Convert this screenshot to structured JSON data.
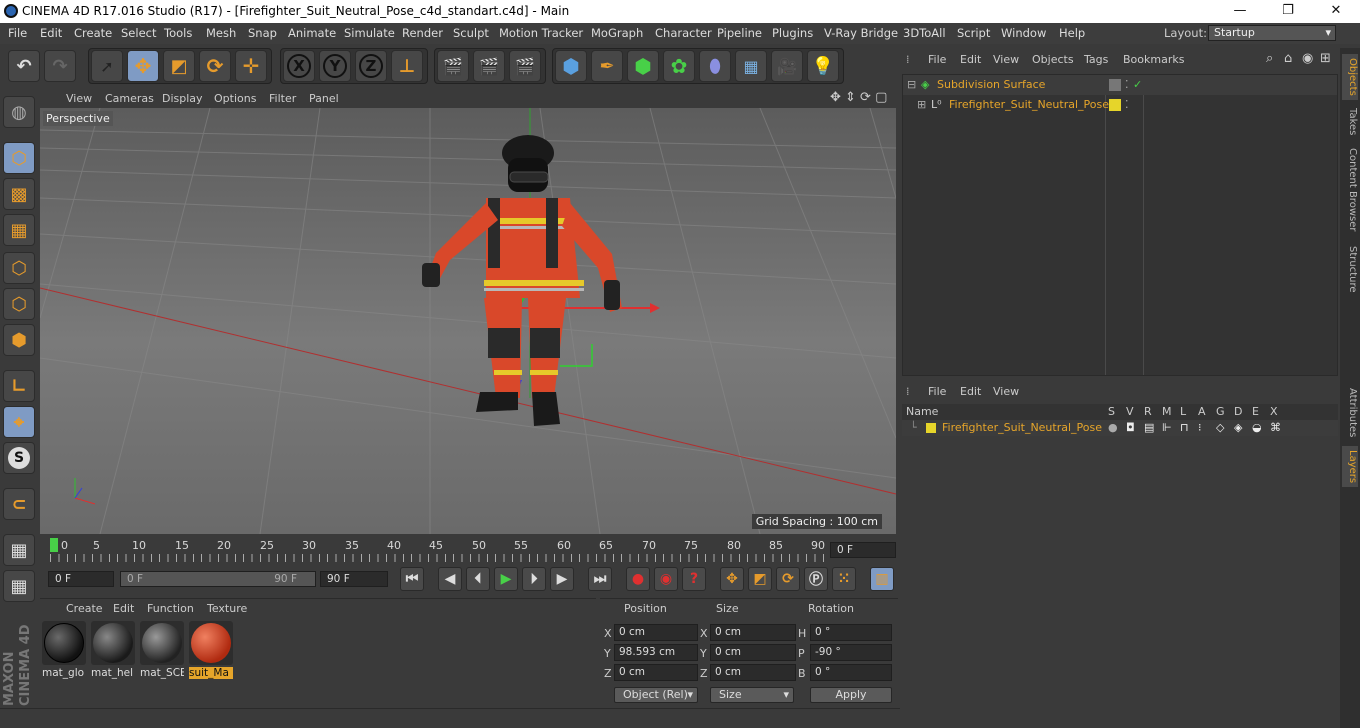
{
  "titlebar": {
    "title": "CINEMA 4D R17.016 Studio (R17) - [Firefighter_Suit_Neutral_Pose_c4d_standart.c4d] - Main",
    "minimize": "—",
    "restore": "❐",
    "close": "✕"
  },
  "menubar": {
    "items": [
      "File",
      "Edit",
      "Create",
      "Select",
      "Tools",
      "Mesh",
      "Snap",
      "Animate",
      "Simulate",
      "Render",
      "Sculpt",
      "Motion Tracker",
      "MoGraph",
      "Character",
      "Pipeline",
      "Plugins",
      "V-Ray Bridge",
      "3DToAll",
      "Script",
      "Window",
      "Help"
    ],
    "layout_label": "Layout:",
    "layout_value": "Startup"
  },
  "toolbar": {
    "axis_x": "X",
    "axis_y": "Y",
    "axis_z": "Z"
  },
  "viewport": {
    "menu": [
      "View",
      "Cameras",
      "Display",
      "Options",
      "Filter",
      "Panel"
    ],
    "camera_label": "Perspective",
    "grid_spacing": "Grid Spacing : 100 cm"
  },
  "timeline": {
    "ticks": [
      "0",
      "5",
      "10",
      "15",
      "20",
      "25",
      "30",
      "35",
      "40",
      "45",
      "50",
      "55",
      "60",
      "65",
      "70",
      "75",
      "80",
      "85",
      "90"
    ],
    "current_frame": "0 F"
  },
  "playbar": {
    "start": "0 F",
    "range_start": "0 F",
    "range_end": "90 F",
    "end": "90 F"
  },
  "materials": {
    "menu": [
      "Create",
      "Edit",
      "Function",
      "Texture"
    ],
    "items": [
      {
        "label": "mat_glo",
        "color": "#2a2a2a"
      },
      {
        "label": "mat_hel",
        "color": "#3a3a3a"
      },
      {
        "label": "mat_SCE",
        "color": "#4a4a4a"
      },
      {
        "label": "suit_Ma",
        "color": "#d24a2a"
      }
    ],
    "selected_label": "suit_Ma"
  },
  "coords": {
    "headers": [
      "Position",
      "Size",
      "Rotation"
    ],
    "rows": [
      {
        "axis": "X",
        "pos": "0 cm",
        "saxis": "X",
        "size": "0 cm",
        "raxis": "H",
        "rot": "0 °"
      },
      {
        "axis": "Y",
        "pos": "98.593 cm",
        "saxis": "Y",
        "size": "0 cm",
        "raxis": "P",
        "rot": "-90 °"
      },
      {
        "axis": "Z",
        "pos": "0 cm",
        "saxis": "Z",
        "size": "0 cm",
        "raxis": "B",
        "rot": "0 °"
      }
    ],
    "mode": "Object (Rel)",
    "size_mode": "Size",
    "apply": "Apply"
  },
  "objects": {
    "menu": [
      "File",
      "Edit",
      "View",
      "Objects",
      "Tags",
      "Bookmarks"
    ],
    "items": [
      "Subdivision Surface",
      "Firefighter_Suit_Neutral_Pose"
    ]
  },
  "layers": {
    "menu": [
      "File",
      "Edit",
      "View"
    ],
    "name_header": "Name",
    "flags": [
      "S",
      "V",
      "R",
      "M",
      "L",
      "A",
      "G",
      "D",
      "E",
      "X"
    ],
    "items": [
      "Firefighter_Suit_Neutral_Pose"
    ]
  },
  "sidetabs": {
    "top": [
      "Objects",
      "Takes",
      "Content Browser",
      "Structure"
    ],
    "bottom": [
      "Attributes",
      "Layers"
    ]
  },
  "brand": "MAXON CINEMA 4D"
}
